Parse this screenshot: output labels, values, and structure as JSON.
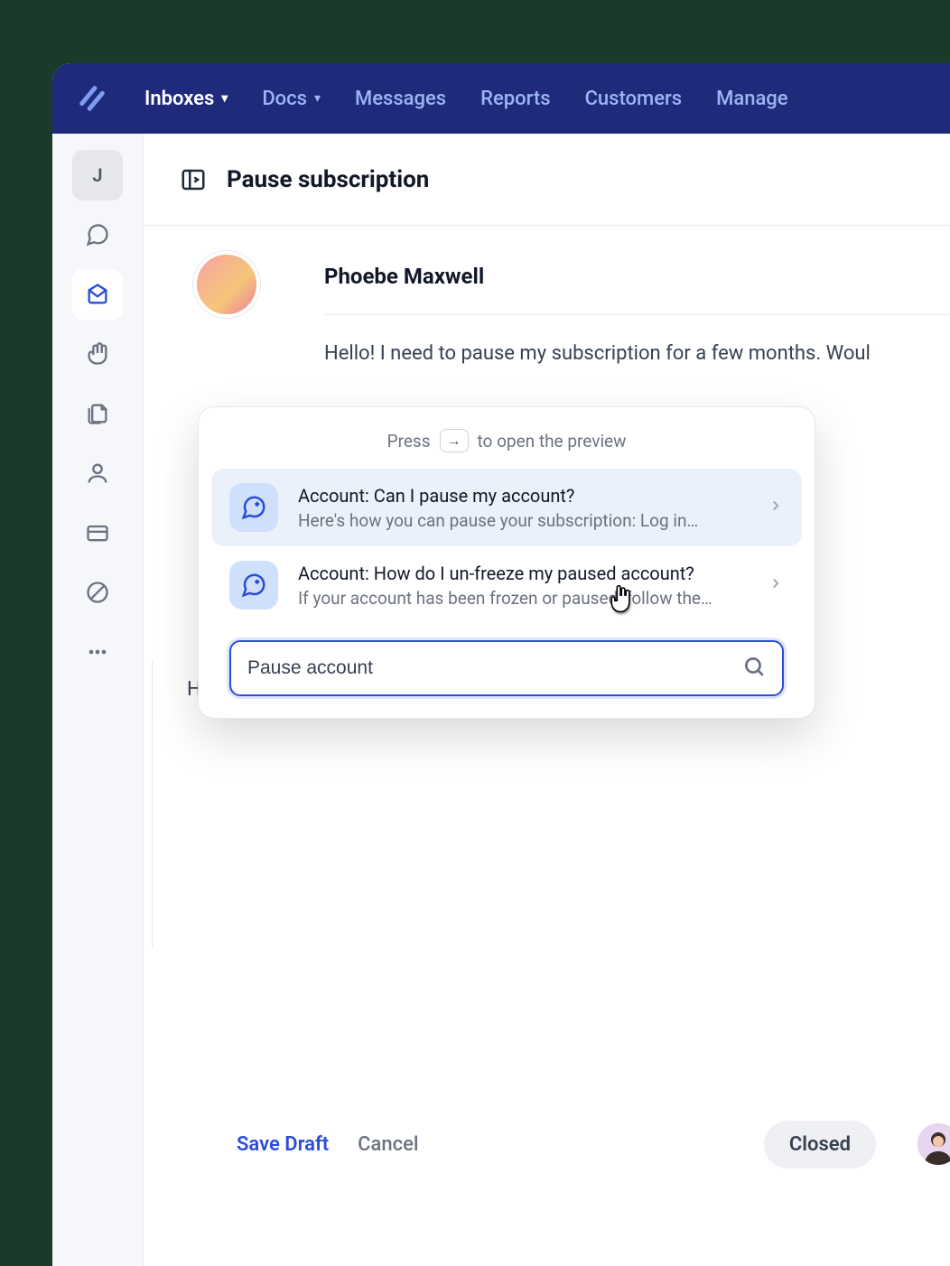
{
  "nav": {
    "items": [
      {
        "label": "Inboxes",
        "active": true,
        "dropdown": true
      },
      {
        "label": "Docs",
        "active": false,
        "dropdown": true
      },
      {
        "label": "Messages",
        "active": false,
        "dropdown": false
      },
      {
        "label": "Reports",
        "active": false,
        "dropdown": false
      },
      {
        "label": "Customers",
        "active": false,
        "dropdown": false
      },
      {
        "label": "Manage",
        "active": false,
        "dropdown": false
      }
    ]
  },
  "sidebar": {
    "user_initial": "J"
  },
  "conversation": {
    "title": "Pause subscription",
    "sender": "Phoebe Maxwell",
    "message": "Hello! I need to pause my subscription for a few months. Woul"
  },
  "popup": {
    "hint_pre": "Press",
    "hint_key": "→",
    "hint_post": "to open the preview",
    "results": [
      {
        "title": "Account:  Can I pause my account?",
        "subtitle": "Here's how you can pause your subscription: Log in…"
      },
      {
        "title": "Account: How do I un-freeze my paused account?",
        "subtitle": "If your account has been frozen or paused, follow the…"
      }
    ],
    "search_value": "Pause account"
  },
  "compose": {
    "text": "Hi Phoebe, happy to help",
    "slash": "/"
  },
  "footer": {
    "save": "Save Draft",
    "cancel": "Cancel",
    "status": "Closed"
  }
}
